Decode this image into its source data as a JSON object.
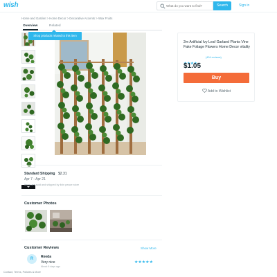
{
  "header": {
    "logo": "wish",
    "search_placeholder": "What do you want to find?",
    "search_button": "Search",
    "sign_in": "Sign in"
  },
  "breadcrumb": [
    "Home and Garden",
    "Home Decor",
    "Decorative Accents",
    "Wax Fruits"
  ],
  "breadcrumb_separator": " > ",
  "tabs": [
    {
      "label": "Overview",
      "active": true
    },
    {
      "label": "Related",
      "active": false
    }
  ],
  "tooltip": "Shop products related to this item",
  "product": {
    "title": "2m Artificial Ivy Leaf Garland Plants Vine Fake Foliage Flowers Home Decor vitality",
    "rating": 4,
    "rating_max": 5,
    "reviews_count": "(434 reviews)",
    "price": "$1.05",
    "buy_label": "Buy",
    "wishlist_label": "Add to Wishlist"
  },
  "shipping": {
    "title": "Standard Shipping",
    "price": "$2.31",
    "dates": "Apr 7 - Apr 21",
    "note": "Items are sold and shipped by lixin peace store"
  },
  "customer_photos": {
    "title": "Customer Photos"
  },
  "customer_reviews": {
    "title": "Customer Reviews",
    "show_more": "Show More",
    "items": [
      {
        "initial": "R",
        "name": "Reeda",
        "rating": 5,
        "text": "Very nice",
        "time": "About 6 days ago"
      }
    ]
  },
  "footer": "Contact, Terms, Policies & More",
  "colors": {
    "brand": "#2fb7ec",
    "buy": "#f46c39",
    "text": "#192a32",
    "muted": "#7d8c94"
  },
  "icons": [
    "search-icon",
    "star-icon",
    "heart-icon",
    "chevron-down-icon"
  ]
}
